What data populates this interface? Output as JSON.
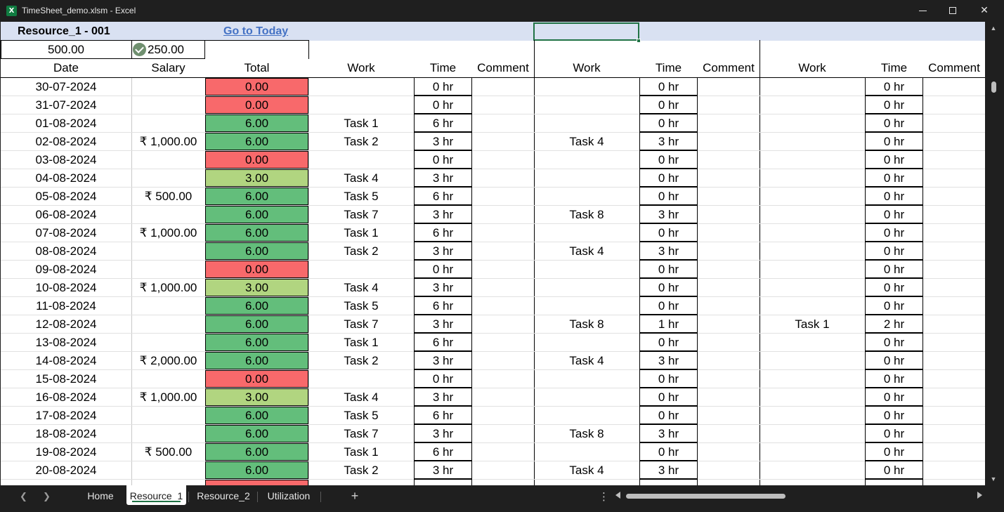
{
  "window": {
    "title": "TimeSheet_demo.xlsm - Excel",
    "app_icon": "X"
  },
  "sheet_header": {
    "title": "Resource_1 - 001",
    "goto_link": "Go to Today",
    "rate_value": "500.00",
    "checked_value": "250.00"
  },
  "columns": {
    "date": "Date",
    "salary": "Salary",
    "total": "Total",
    "work": "Work",
    "time": "Time",
    "comment": "Comment"
  },
  "colors": {
    "red": "#f8696b",
    "green": "#63be7b",
    "lightgreen": "#b1d580",
    "header_band": "#d9e1f2",
    "selection": "#217346"
  },
  "rows": [
    {
      "date": "30-07-2024",
      "salary": "",
      "total": "0.00",
      "status": "red",
      "work1": "",
      "time1": "0 hr",
      "work2": "",
      "time2": "0 hr",
      "work3": "",
      "time3": "0 hr"
    },
    {
      "date": "31-07-2024",
      "salary": "",
      "total": "0.00",
      "status": "red",
      "work1": "",
      "time1": "0 hr",
      "work2": "",
      "time2": "0 hr",
      "work3": "",
      "time3": "0 hr"
    },
    {
      "date": "01-08-2024",
      "salary": "",
      "total": "6.00",
      "status": "green",
      "work1": "Task 1",
      "time1": "6 hr",
      "work2": "",
      "time2": "0 hr",
      "work3": "",
      "time3": "0 hr"
    },
    {
      "date": "02-08-2024",
      "salary": "₹ 1,000.00",
      "total": "6.00",
      "status": "green",
      "work1": "Task 2",
      "time1": "3 hr",
      "work2": "Task 4",
      "time2": "3 hr",
      "work3": "",
      "time3": "0 hr"
    },
    {
      "date": "03-08-2024",
      "salary": "",
      "total": "0.00",
      "status": "red",
      "work1": "",
      "time1": "0 hr",
      "work2": "",
      "time2": "0 hr",
      "work3": "",
      "time3": "0 hr"
    },
    {
      "date": "04-08-2024",
      "salary": "",
      "total": "3.00",
      "status": "lightgreen",
      "work1": "Task 4",
      "time1": "3 hr",
      "work2": "",
      "time2": "0 hr",
      "work3": "",
      "time3": "0 hr"
    },
    {
      "date": "05-08-2024",
      "salary": "₹ 500.00",
      "total": "6.00",
      "status": "green",
      "work1": "Task 5",
      "time1": "6 hr",
      "work2": "",
      "time2": "0 hr",
      "work3": "",
      "time3": "0 hr"
    },
    {
      "date": "06-08-2024",
      "salary": "",
      "total": "6.00",
      "status": "green",
      "work1": "Task 7",
      "time1": "3 hr",
      "work2": "Task 8",
      "time2": "3 hr",
      "work3": "",
      "time3": "0 hr"
    },
    {
      "date": "07-08-2024",
      "salary": "₹ 1,000.00",
      "total": "6.00",
      "status": "green",
      "work1": "Task 1",
      "time1": "6 hr",
      "work2": "",
      "time2": "0 hr",
      "work3": "",
      "time3": "0 hr"
    },
    {
      "date": "08-08-2024",
      "salary": "",
      "total": "6.00",
      "status": "green",
      "work1": "Task 2",
      "time1": "3 hr",
      "work2": "Task 4",
      "time2": "3 hr",
      "work3": "",
      "time3": "0 hr"
    },
    {
      "date": "09-08-2024",
      "salary": "",
      "total": "0.00",
      "status": "red",
      "work1": "",
      "time1": "0 hr",
      "work2": "",
      "time2": "0 hr",
      "work3": "",
      "time3": "0 hr"
    },
    {
      "date": "10-08-2024",
      "salary": "₹ 1,000.00",
      "total": "3.00",
      "status": "lightgreen",
      "work1": "Task 4",
      "time1": "3 hr",
      "work2": "",
      "time2": "0 hr",
      "work3": "",
      "time3": "0 hr"
    },
    {
      "date": "11-08-2024",
      "salary": "",
      "total": "6.00",
      "status": "green",
      "work1": "Task 5",
      "time1": "6 hr",
      "work2": "",
      "time2": "0 hr",
      "work3": "",
      "time3": "0 hr"
    },
    {
      "date": "12-08-2024",
      "salary": "",
      "total": "6.00",
      "status": "green",
      "work1": "Task 7",
      "time1": "3 hr",
      "work2": "Task 8",
      "time2": "1 hr",
      "work3": "Task 1",
      "time3": "2 hr"
    },
    {
      "date": "13-08-2024",
      "salary": "",
      "total": "6.00",
      "status": "green",
      "work1": "Task 1",
      "time1": "6 hr",
      "work2": "",
      "time2": "0 hr",
      "work3": "",
      "time3": "0 hr"
    },
    {
      "date": "14-08-2024",
      "salary": "₹ 2,000.00",
      "total": "6.00",
      "status": "green",
      "work1": "Task 2",
      "time1": "3 hr",
      "work2": "Task 4",
      "time2": "3 hr",
      "work3": "",
      "time3": "0 hr"
    },
    {
      "date": "15-08-2024",
      "salary": "",
      "total": "0.00",
      "status": "red",
      "work1": "",
      "time1": "0 hr",
      "work2": "",
      "time2": "0 hr",
      "work3": "",
      "time3": "0 hr"
    },
    {
      "date": "16-08-2024",
      "salary": "₹ 1,000.00",
      "total": "3.00",
      "status": "lightgreen",
      "work1": "Task 4",
      "time1": "3 hr",
      "work2": "",
      "time2": "0 hr",
      "work3": "",
      "time3": "0 hr"
    },
    {
      "date": "17-08-2024",
      "salary": "",
      "total": "6.00",
      "status": "green",
      "work1": "Task 5",
      "time1": "6 hr",
      "work2": "",
      "time2": "0 hr",
      "work3": "",
      "time3": "0 hr"
    },
    {
      "date": "18-08-2024",
      "salary": "",
      "total": "6.00",
      "status": "green",
      "work1": "Task 7",
      "time1": "3 hr",
      "work2": "Task 8",
      "time2": "3 hr",
      "work3": "",
      "time3": "0 hr"
    },
    {
      "date": "19-08-2024",
      "salary": "₹ 500.00",
      "total": "6.00",
      "status": "green",
      "work1": "Task 1",
      "time1": "6 hr",
      "work2": "",
      "time2": "0 hr",
      "work3": "",
      "time3": "0 hr"
    },
    {
      "date": "20-08-2024",
      "salary": "",
      "total": "6.00",
      "status": "green",
      "work1": "Task 2",
      "time1": "3 hr",
      "work2": "Task 4",
      "time2": "3 hr",
      "work3": "",
      "time3": "0 hr"
    }
  ],
  "tabs": {
    "home": "Home",
    "resource1": "Resource_1",
    "resource2": "Resource_2",
    "utilization": "Utilization",
    "add": "+",
    "more": "⋮"
  }
}
